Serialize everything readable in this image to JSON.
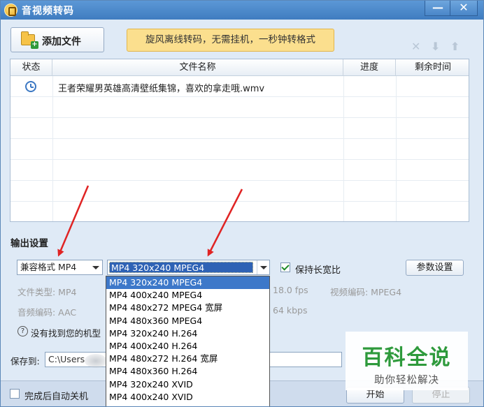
{
  "window": {
    "title": "音视频转码",
    "minimize_glyph": "—",
    "close_glyph": "✕"
  },
  "toolbar": {
    "add_file_label": "添加文件",
    "promo_text": "旋风离线转码，无需挂机，一秒钟转格式",
    "icons": [
      "delete-icon",
      "move-down-icon",
      "move-up-icon"
    ]
  },
  "table": {
    "columns": [
      "状态",
      "文件名称",
      "进度",
      "剩余时间"
    ],
    "rows": [
      {
        "status_icon": "clock-icon",
        "name": "王者荣耀男英雄高清壁纸集锦，喜欢的拿走哦.wmv",
        "progress": "",
        "remaining": ""
      }
    ]
  },
  "output": {
    "section_label": "输出设置",
    "format_select": "兼容格式 MP4",
    "profile_select": "MP4 320x240 MPEG4",
    "keep_ratio_label": "保持长宽比",
    "keep_ratio_checked": true,
    "param_button": "参数设置",
    "file_type": "文件类型: MP4",
    "audio_codec": "音频编码: AAC",
    "frame_rate": "18.0 fps",
    "video_codec": "视频编码: MPEG4",
    "bitrate": "64 kbps",
    "help_text": "没有找到您的机型"
  },
  "dropdown": {
    "selected_index": 0,
    "options": [
      "MP4 320x240 MPEG4",
      "MP4 400x240 MPEG4",
      "MP4 480x272 MPEG4 宽屏",
      "MP4 480x360 MPEG4",
      "MP4 320x240 H.264",
      "MP4 400x240 H.264",
      "MP4 480x272 H.264 宽屏",
      "MP4 480x360 H.264",
      "MP4 320x240 XVID",
      "MP4 400x240 XVID"
    ]
  },
  "saveto": {
    "label": "保存到:",
    "path": "C:\\Users"
  },
  "footer": {
    "shutdown_label": "完成后自动关机",
    "start_button": "开始",
    "stop_button": "停止"
  },
  "watermark": {
    "logo": "百科全说",
    "sub": "助你轻松解决"
  },
  "colors": {
    "titlebar": "#3f7cc0",
    "selection": "#3d78c9",
    "promo": "#fbdf8e",
    "arrow": "#e02424",
    "watermark": "#2e9a3c"
  }
}
